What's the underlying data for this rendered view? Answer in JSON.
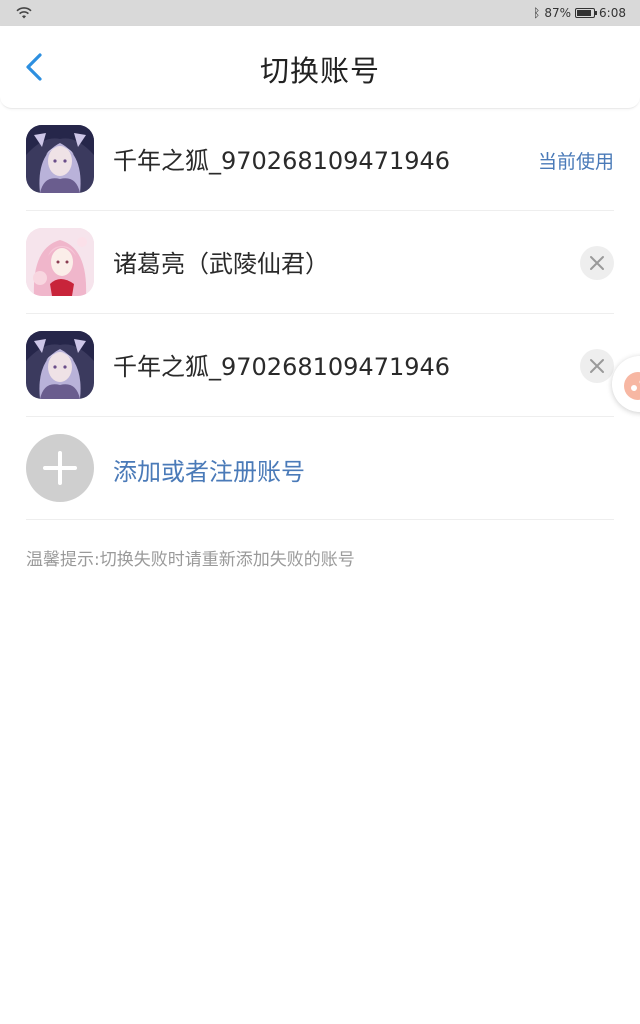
{
  "status_bar": {
    "battery": "87%",
    "battery_level": 0.87,
    "time": "6:08",
    "icons": [
      "wifi-icon",
      "bluetooth-icon",
      "battery-icon"
    ]
  },
  "header": {
    "title": "切换账号",
    "back_icon": "chevron-left-icon",
    "accent": "#2d8fe0"
  },
  "accounts": [
    {
      "name": "千年之狐_970268109471946",
      "status": "当前使用",
      "avatar": "fox-character-avatar"
    },
    {
      "name": "诸葛亮（武陵仙君）",
      "action_icon": "close-icon",
      "avatar": "pink-hair-character-avatar"
    },
    {
      "name": "千年之狐_970268109471946",
      "action_icon": "close-icon",
      "avatar": "fox-character-avatar"
    }
  ],
  "add_account": {
    "label": "添加或者注册账号",
    "icon": "plus-icon"
  },
  "tip": "温馨提示:切换失败时请重新添加失败的账号",
  "colors": {
    "link_blue": "#4a7ab8",
    "status_bar_bg": "#d9d9d9"
  }
}
